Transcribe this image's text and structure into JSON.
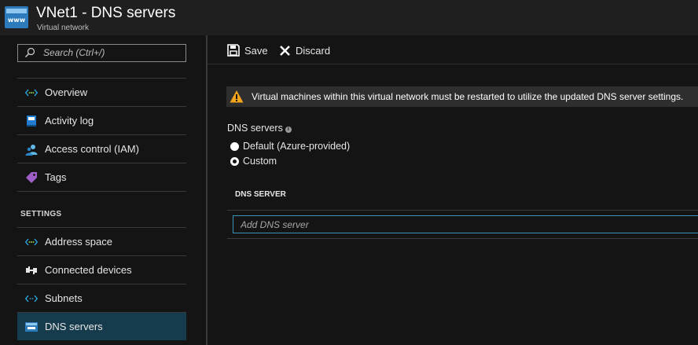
{
  "header": {
    "title": "VNet1 - DNS servers",
    "subtitle": "Virtual network",
    "app_icon_text": "www"
  },
  "sidebar": {
    "search_placeholder": "Search (Ctrl+/)",
    "items": [
      {
        "label": "Overview",
        "icon": "network-arrows-icon"
      },
      {
        "label": "Activity log",
        "icon": "activity-log-icon"
      },
      {
        "label": "Access control (IAM)",
        "icon": "users-icon"
      },
      {
        "label": "Tags",
        "icon": "tag-icon"
      }
    ],
    "settings_label": "SETTINGS",
    "settings_items": [
      {
        "label": "Address space",
        "icon": "network-arrows-icon"
      },
      {
        "label": "Connected devices",
        "icon": "connected-devices-icon"
      },
      {
        "label": "Subnets",
        "icon": "subnet-arrows-icon"
      },
      {
        "label": "DNS servers",
        "icon": "dns-servers-icon",
        "active": true
      }
    ]
  },
  "toolbar": {
    "save_label": "Save",
    "discard_label": "Discard"
  },
  "main": {
    "warning_text": "Virtual machines within this virtual network must be restarted to utilize the updated DNS server settings.",
    "dns_servers_label": "DNS servers",
    "radio_default_label": "Default (Azure-provided)",
    "radio_custom_label": "Custom",
    "selected": "Custom",
    "column_header": "DNS SERVER",
    "dns_input_placeholder": "Add DNS server"
  },
  "colors": {
    "accent_active": "#163b4d",
    "input_border": "#3b93b5",
    "warning_icon": "#f2a51a"
  }
}
